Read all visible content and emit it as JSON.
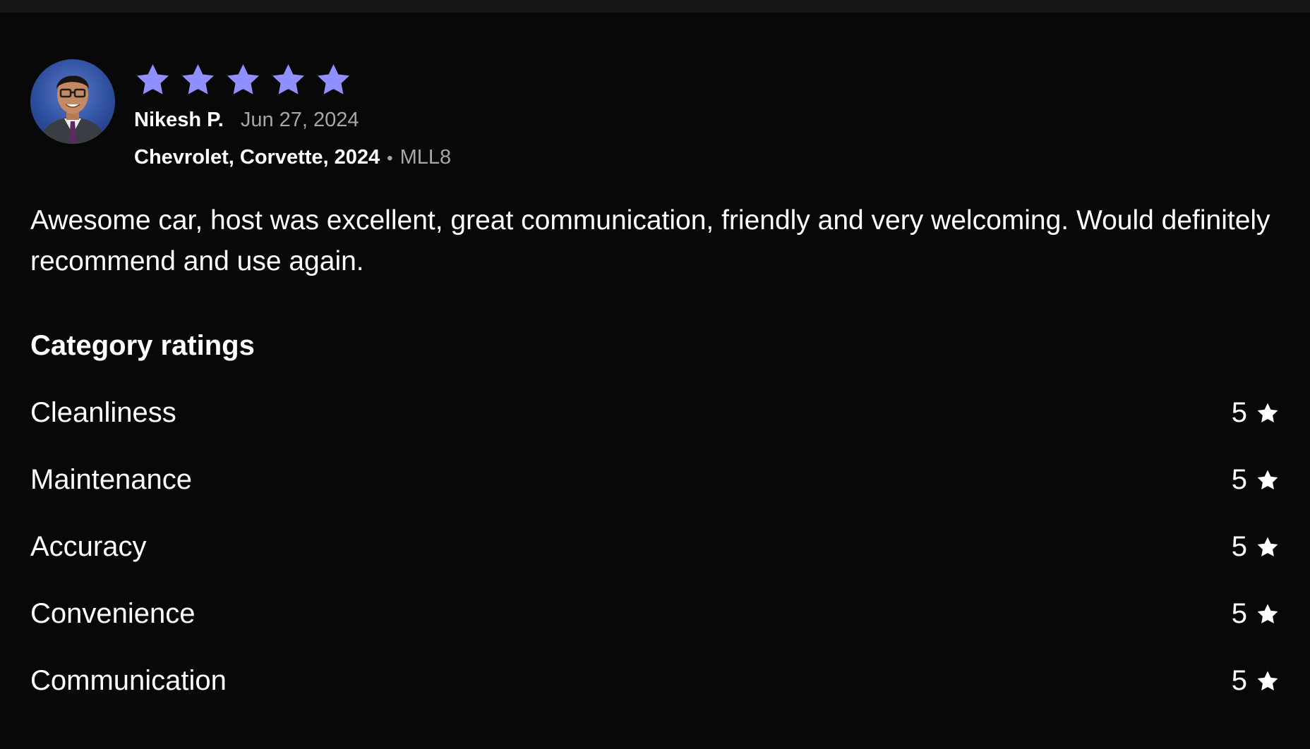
{
  "colors": {
    "background": "#080808",
    "top_strip": "#17171a",
    "star_accent": "#8f8fff",
    "text_primary": "#ffffff",
    "text_secondary": "#a7a7a7"
  },
  "review": {
    "avatar_icon": "user-avatar-photo",
    "overall_rating": 5,
    "overall_rating_max": 5,
    "reviewer_name": "Nikesh P.",
    "date": "Jun 27, 2024",
    "vehicle": "Chevrolet, Corvette, 2024",
    "separator": "•",
    "plate": "MLL8",
    "text": "Awesome car, host was excellent, great communication, friendly and very welcoming. Would definitely recommend and use again."
  },
  "category_ratings": {
    "title": "Category ratings",
    "items": [
      {
        "label": "Cleanliness",
        "value": "5",
        "icon": "star-icon"
      },
      {
        "label": "Maintenance",
        "value": "5",
        "icon": "star-icon"
      },
      {
        "label": "Accuracy",
        "value": "5",
        "icon": "star-icon"
      },
      {
        "label": "Convenience",
        "value": "5",
        "icon": "star-icon"
      },
      {
        "label": "Communication",
        "value": "5",
        "icon": "star-icon"
      }
    ]
  }
}
